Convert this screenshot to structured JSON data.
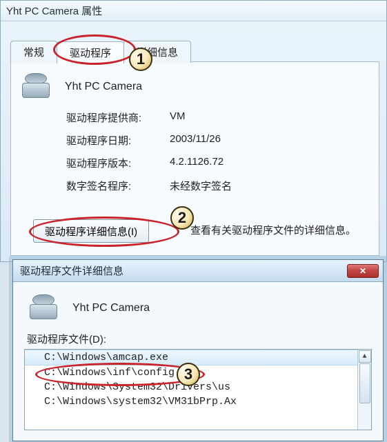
{
  "annotations": {
    "step1": "1",
    "step2": "2",
    "step3": "3"
  },
  "properties_window": {
    "title": "Yht PC Camera 属性",
    "tabs": {
      "general": "常规",
      "driver": "驱动程序",
      "details": "详细信息"
    },
    "device_name": "Yht PC Camera",
    "info": {
      "provider_label": "驱动程序提供商:",
      "provider_value": "VM",
      "date_label": "驱动程序日期:",
      "date_value": "2003/11/26",
      "version_label": "驱动程序版本:",
      "version_value": "4.2.1126.72",
      "signer_label": "数字签名程序:",
      "signer_value": "未经数字签名"
    },
    "details_button": "驱动程序详细信息(I)",
    "details_desc": "查看有关驱动程序文件的详细信息。"
  },
  "details_window": {
    "title": "驱动程序文件详细信息",
    "device_name": "Yht PC Camera",
    "files_label": "驱动程序文件(D):",
    "files": [
      "C:\\Windows\\amcap.exe",
      "C:\\Windows\\inf\\config.set",
      "C:\\Windows\\System32\\Drivers\\us",
      "C:\\Windows\\system32\\VM31bPrp.Ax"
    ]
  }
}
